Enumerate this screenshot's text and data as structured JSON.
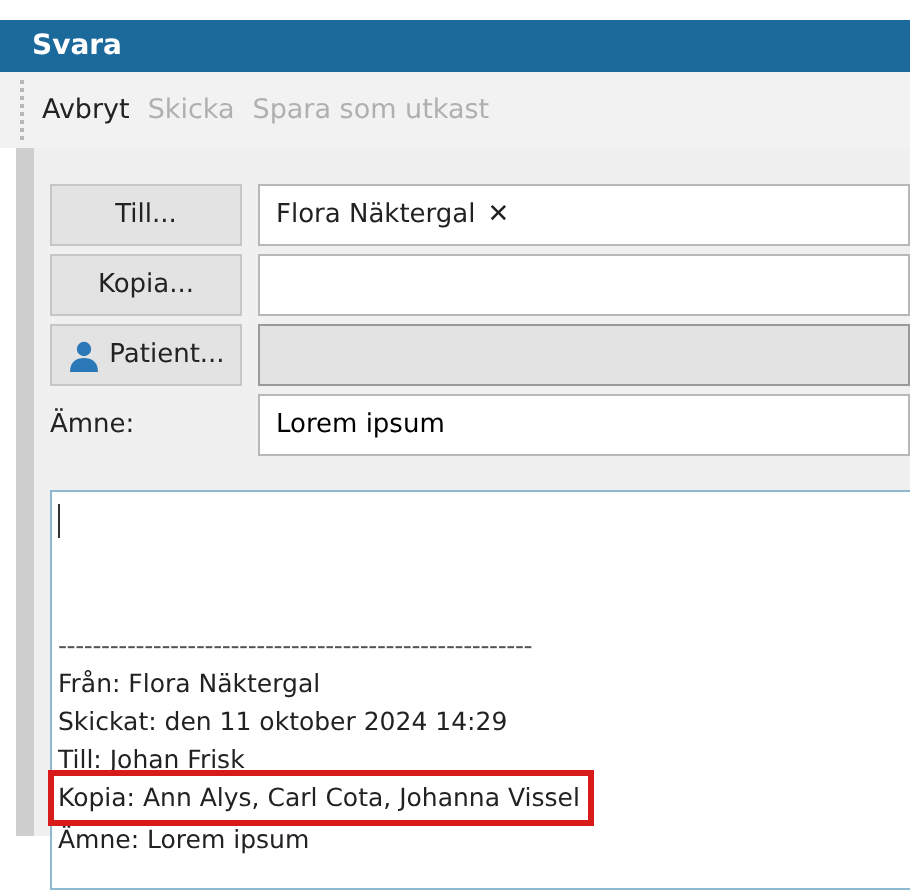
{
  "window": {
    "title": "Svara"
  },
  "toolbar": [
    {
      "label": "Avbryt",
      "disabled": false
    },
    {
      "label": "Skicka",
      "disabled": true
    },
    {
      "label": "Spara som utkast",
      "disabled": true
    }
  ],
  "header_rows": [
    {
      "kind": "button",
      "label": "Till...",
      "icon": false,
      "chip": {
        "text": "Flora Näktergal",
        "remove": "✕"
      }
    },
    {
      "kind": "button",
      "label": "Kopia...",
      "icon": false,
      "readonly": false
    },
    {
      "kind": "button",
      "label": "Patient...",
      "icon": true,
      "readonly": true
    },
    {
      "kind": "label",
      "label": "Ämne:",
      "value": "Lorem ipsum",
      "readonly": false
    }
  ],
  "body": {
    "separator": "-------------------------------------------------------",
    "quoted_lines": [
      {
        "text": "Från: Flora Näktergal",
        "highlighted": false
      },
      {
        "text": "Skickat: den 11 oktober 2024 14:29",
        "highlighted": false
      },
      {
        "text": "Till: Johan Frisk",
        "highlighted": false
      },
      {
        "text": "Kopia: Ann Alys, Carl Cota, Johanna Vissel",
        "highlighted": true
      },
      {
        "text": "Ämne: Lorem ipsum",
        "highlighted": false
      }
    ]
  }
}
